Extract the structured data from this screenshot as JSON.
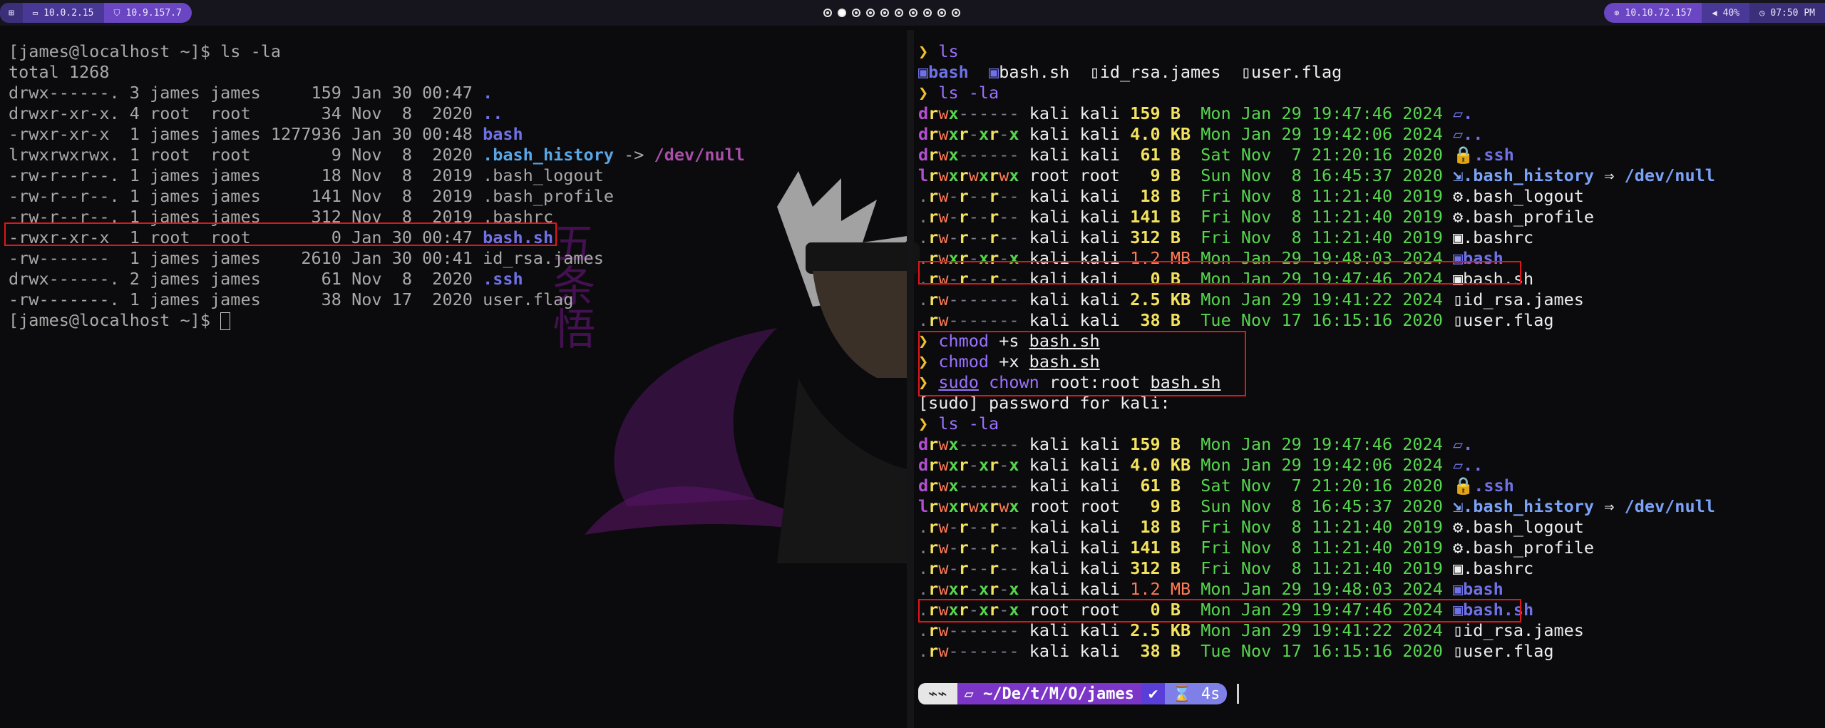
{
  "topbar": {
    "menu_icon": "grid-icon",
    "left_chips": [
      {
        "icon": "monitor-icon",
        "label": "10.0.2.15"
      },
      {
        "icon": "shield-icon",
        "label": "10.9.157.7"
      }
    ],
    "workspaces": [
      "1",
      "2",
      "3",
      "4",
      "5",
      "6",
      "7",
      "8",
      "9",
      "10"
    ],
    "active_workspace": 2,
    "right_chips": [
      {
        "icon": "target-icon",
        "label": "10.10.72.157"
      },
      {
        "icon": "volume-icon",
        "label": "40%"
      },
      {
        "icon": "clock-icon",
        "label": "07:50 PM"
      }
    ]
  },
  "left_terminal": {
    "prompt": "[james@localhost ~]$ ",
    "command": "ls -la",
    "total": "total 1268",
    "entries": [
      {
        "perm": "drwx------.",
        "links": "3",
        "owner": "james",
        "group": "james",
        "size": "159",
        "date": "Jan 30 00:47",
        "name": ".",
        "style": "blue"
      },
      {
        "perm": "drwxr-xr-x.",
        "links": "4",
        "owner": "root",
        "group": "root",
        "size": "34",
        "date": "Nov  8  2020",
        "name": "..",
        "style": "blue"
      },
      {
        "perm": "-rwxr-xr-x",
        "links": "1",
        "owner": "james",
        "group": "james",
        "size": "1277936",
        "date": "Jan 30 00:48",
        "name": "bash",
        "style": "blue"
      },
      {
        "perm": "lrwxrwxrwx.",
        "links": "1",
        "owner": "root",
        "group": "root",
        "size": "9",
        "date": "Nov  8  2020",
        "name": ".bash_history",
        "arrow": "->",
        "target": "/dev/null",
        "style": "cyan"
      },
      {
        "perm": "-rw-r--r--.",
        "links": "1",
        "owner": "james",
        "group": "james",
        "size": "18",
        "date": "Nov  8  2019",
        "name": ".bash_logout",
        "style": "gray"
      },
      {
        "perm": "-rw-r--r--.",
        "links": "1",
        "owner": "james",
        "group": "james",
        "size": "141",
        "date": "Nov  8  2019",
        "name": ".bash_profile",
        "style": "gray"
      },
      {
        "perm": "-rw-r--r--.",
        "links": "1",
        "owner": "james",
        "group": "james",
        "size": "312",
        "date": "Nov  8  2019",
        "name": ".bashrc",
        "style": "gray"
      },
      {
        "perm": "-rwxr-xr-x",
        "links": "1",
        "owner": "root",
        "group": "root",
        "size": "0",
        "date": "Jan 30 00:47",
        "name": "bash.sh",
        "style": "blue"
      },
      {
        "perm": "-rw-------",
        "links": "1",
        "owner": "james",
        "group": "james",
        "size": "2610",
        "date": "Jan 30 00:41",
        "name": "id_rsa.james",
        "style": "gray"
      },
      {
        "perm": "drwx------.",
        "links": "2",
        "owner": "james",
        "group": "james",
        "size": "61",
        "date": "Nov  8  2020",
        "name": ".ssh",
        "style": "blue"
      },
      {
        "perm": "-rw-------.",
        "links": "1",
        "owner": "james",
        "group": "james",
        "size": "38",
        "date": "Nov 17  2020",
        "name": "user.flag",
        "style": "gray"
      }
    ],
    "final_prompt": "[james@localhost ~]$ "
  },
  "right_terminal": {
    "prompt_char": "❯",
    "cmd_ls": "ls",
    "ls_output": [
      {
        "name": "bash",
        "kind": "exec"
      },
      {
        "name": "bash.sh",
        "kind": "script"
      },
      {
        "name": "id_rsa.james",
        "kind": "file"
      },
      {
        "name": "user.flag",
        "kind": "file"
      }
    ],
    "cmd_ls_la": "ls -la",
    "listing_1": [
      {
        "perm": "drwx------",
        "owner": "kali",
        "group": "kali",
        "size": "159",
        "unit": "B",
        "date": "Mon Jan 29 19:47:46 2024",
        "icon": "folder-open-icon",
        "name": "."
      },
      {
        "perm": "drwxr-xr-x",
        "owner": "kali",
        "group": "kali",
        "size": "4.0",
        "unit": "KB",
        "date": "Mon Jan 29 19:42:06 2024",
        "icon": "folder-open-icon",
        "name": ".."
      },
      {
        "perm": "drwx------",
        "owner": "kali",
        "group": "kali",
        "size": "61",
        "unit": "B",
        "date": "Sat Nov  7 21:20:16 2020",
        "icon": "lock-icon",
        "name": ".ssh"
      },
      {
        "perm": "lrwxrwxrwx",
        "owner": "root",
        "group": "root",
        "size": "9",
        "unit": "B",
        "date": "Sun Nov  8 16:45:37 2020",
        "icon": "file-link-icon",
        "name": ".bash_history",
        "arrow": "⇒",
        "target": "/dev/null"
      },
      {
        "perm": ".rw-r--r--",
        "owner": "kali",
        "group": "kali",
        "size": "18",
        "unit": "B",
        "date": "Fri Nov  8 11:21:40 2019",
        "icon": "gear-icon",
        "name": ".bash_logout"
      },
      {
        "perm": ".rw-r--r--",
        "owner": "kali",
        "group": "kali",
        "size": "141",
        "unit": "B",
        "date": "Fri Nov  8 11:21:40 2019",
        "icon": "gear-icon",
        "name": ".bash_profile"
      },
      {
        "perm": ".rw-r--r--",
        "owner": "kali",
        "group": "kali",
        "size": "312",
        "unit": "B",
        "date": "Fri Nov  8 11:21:40 2019",
        "icon": "terminal-icon",
        "name": ".bashrc"
      },
      {
        "perm": ".rwxr-xr-x",
        "owner": "kali",
        "group": "kali",
        "size": "1.2",
        "unit": "MB",
        "date": "Mon Jan 29 19:48:03 2024",
        "icon": "terminal-icon",
        "name": "bash"
      },
      {
        "perm": ".rw-r--r--",
        "owner": "kali",
        "group": "kali",
        "size": "0",
        "unit": "B",
        "date": "Mon Jan 29 19:47:46 2024",
        "icon": "terminal-icon",
        "name": "bash.sh"
      },
      {
        "perm": ".rw-------",
        "owner": "kali",
        "group": "kali",
        "size": "2.5",
        "unit": "KB",
        "date": "Mon Jan 29 19:41:22 2024",
        "icon": "file-icon",
        "name": "id_rsa.james"
      },
      {
        "perm": ".rw-------",
        "owner": "kali",
        "group": "kali",
        "size": "38",
        "unit": "B",
        "date": "Tue Nov 17 16:15:16 2020",
        "icon": "file-icon",
        "name": "user.flag"
      }
    ],
    "cmd_chmod_s": {
      "cmd": "chmod",
      "arg": "+s",
      "file": "bash.sh"
    },
    "cmd_chmod_x": {
      "cmd": "chmod",
      "arg": "+x",
      "file": "bash.sh"
    },
    "cmd_chown": {
      "sudo": "sudo",
      "cmd": "chown",
      "arg": "root:root",
      "file": "bash.sh"
    },
    "sudo_prompt": "[sudo] password for kali:",
    "cmd_ls_la_2": "ls -la",
    "listing_2": [
      {
        "perm": "drwx------",
        "owner": "kali",
        "group": "kali",
        "size": "159",
        "unit": "B",
        "date": "Mon Jan 29 19:47:46 2024",
        "icon": "folder-open-icon",
        "name": "."
      },
      {
        "perm": "drwxr-xr-x",
        "owner": "kali",
        "group": "kali",
        "size": "4.0",
        "unit": "KB",
        "date": "Mon Jan 29 19:42:06 2024",
        "icon": "folder-open-icon",
        "name": ".."
      },
      {
        "perm": "drwx------",
        "owner": "kali",
        "group": "kali",
        "size": "61",
        "unit": "B",
        "date": "Sat Nov  7 21:20:16 2020",
        "icon": "lock-icon",
        "name": ".ssh"
      },
      {
        "perm": "lrwxrwxrwx",
        "owner": "root",
        "group": "root",
        "size": "9",
        "unit": "B",
        "date": "Sun Nov  8 16:45:37 2020",
        "icon": "file-link-icon",
        "name": ".bash_history",
        "arrow": "⇒",
        "target": "/dev/null"
      },
      {
        "perm": ".rw-r--r--",
        "owner": "kali",
        "group": "kali",
        "size": "18",
        "unit": "B",
        "date": "Fri Nov  8 11:21:40 2019",
        "icon": "gear-icon",
        "name": ".bash_logout"
      },
      {
        "perm": ".rw-r--r--",
        "owner": "kali",
        "group": "kali",
        "size": "141",
        "unit": "B",
        "date": "Fri Nov  8 11:21:40 2019",
        "icon": "gear-icon",
        "name": ".bash_profile"
      },
      {
        "perm": ".rw-r--r--",
        "owner": "kali",
        "group": "kali",
        "size": "312",
        "unit": "B",
        "date": "Fri Nov  8 11:21:40 2019",
        "icon": "terminal-icon",
        "name": ".bashrc"
      },
      {
        "perm": ".rwxr-xr-x",
        "owner": "kali",
        "group": "kali",
        "size": "1.2",
        "unit": "MB",
        "date": "Mon Jan 29 19:48:03 2024",
        "icon": "terminal-icon",
        "name": "bash"
      },
      {
        "perm": ".rwxr-xr-x",
        "owner": "root",
        "group": "root",
        "size": "0",
        "unit": "B",
        "date": "Mon Jan 29 19:47:46 2024",
        "icon": "terminal-icon",
        "name": "bash.sh"
      },
      {
        "perm": ".rw-------",
        "owner": "kali",
        "group": "kali",
        "size": "2.5",
        "unit": "KB",
        "date": "Mon Jan 29 19:41:22 2024",
        "icon": "file-icon",
        "name": "id_rsa.james"
      },
      {
        "perm": ".rw-------",
        "owner": "kali",
        "group": "kali",
        "size": "38",
        "unit": "B",
        "date": "Tue Nov 17 16:15:16 2020",
        "icon": "file-icon",
        "name": "user.flag"
      }
    ],
    "powerline": {
      "os_icon": "kali-dragon-icon",
      "dir_icon": "folder-open-icon",
      "dir_prefix": "~/De/t/M/O/",
      "dir_current": "james",
      "status": "✔",
      "time_icon": "hourglass-icon",
      "time": "4s"
    }
  },
  "wallpaper_text": "五条悟",
  "colors": {
    "accent": "#6a46c2",
    "highlight_box": "#e0161b",
    "prompt_arrow": "#f1c12b"
  }
}
